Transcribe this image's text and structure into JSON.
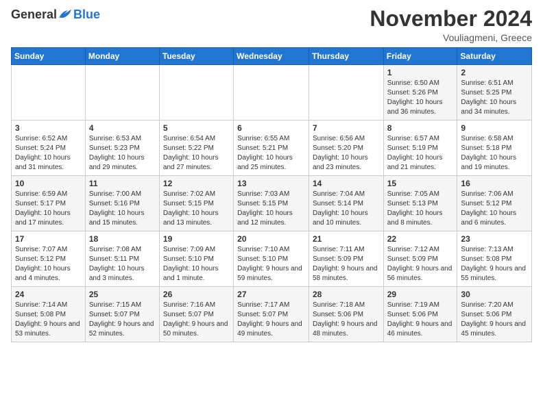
{
  "header": {
    "logo_general": "General",
    "logo_blue": "Blue",
    "month_title": "November 2024",
    "location": "Vouliagmeni, Greece"
  },
  "calendar": {
    "days_of_week": [
      "Sunday",
      "Monday",
      "Tuesday",
      "Wednesday",
      "Thursday",
      "Friday",
      "Saturday"
    ],
    "weeks": [
      [
        {
          "day": "",
          "info": ""
        },
        {
          "day": "",
          "info": ""
        },
        {
          "day": "",
          "info": ""
        },
        {
          "day": "",
          "info": ""
        },
        {
          "day": "",
          "info": ""
        },
        {
          "day": "1",
          "info": "Sunrise: 6:50 AM\nSunset: 5:26 PM\nDaylight: 10 hours and 36 minutes."
        },
        {
          "day": "2",
          "info": "Sunrise: 6:51 AM\nSunset: 5:25 PM\nDaylight: 10 hours and 34 minutes."
        }
      ],
      [
        {
          "day": "3",
          "info": "Sunrise: 6:52 AM\nSunset: 5:24 PM\nDaylight: 10 hours and 31 minutes."
        },
        {
          "day": "4",
          "info": "Sunrise: 6:53 AM\nSunset: 5:23 PM\nDaylight: 10 hours and 29 minutes."
        },
        {
          "day": "5",
          "info": "Sunrise: 6:54 AM\nSunset: 5:22 PM\nDaylight: 10 hours and 27 minutes."
        },
        {
          "day": "6",
          "info": "Sunrise: 6:55 AM\nSunset: 5:21 PM\nDaylight: 10 hours and 25 minutes."
        },
        {
          "day": "7",
          "info": "Sunrise: 6:56 AM\nSunset: 5:20 PM\nDaylight: 10 hours and 23 minutes."
        },
        {
          "day": "8",
          "info": "Sunrise: 6:57 AM\nSunset: 5:19 PM\nDaylight: 10 hours and 21 minutes."
        },
        {
          "day": "9",
          "info": "Sunrise: 6:58 AM\nSunset: 5:18 PM\nDaylight: 10 hours and 19 minutes."
        }
      ],
      [
        {
          "day": "10",
          "info": "Sunrise: 6:59 AM\nSunset: 5:17 PM\nDaylight: 10 hours and 17 minutes."
        },
        {
          "day": "11",
          "info": "Sunrise: 7:00 AM\nSunset: 5:16 PM\nDaylight: 10 hours and 15 minutes."
        },
        {
          "day": "12",
          "info": "Sunrise: 7:02 AM\nSunset: 5:15 PM\nDaylight: 10 hours and 13 minutes."
        },
        {
          "day": "13",
          "info": "Sunrise: 7:03 AM\nSunset: 5:15 PM\nDaylight: 10 hours and 12 minutes."
        },
        {
          "day": "14",
          "info": "Sunrise: 7:04 AM\nSunset: 5:14 PM\nDaylight: 10 hours and 10 minutes."
        },
        {
          "day": "15",
          "info": "Sunrise: 7:05 AM\nSunset: 5:13 PM\nDaylight: 10 hours and 8 minutes."
        },
        {
          "day": "16",
          "info": "Sunrise: 7:06 AM\nSunset: 5:12 PM\nDaylight: 10 hours and 6 minutes."
        }
      ],
      [
        {
          "day": "17",
          "info": "Sunrise: 7:07 AM\nSunset: 5:12 PM\nDaylight: 10 hours and 4 minutes."
        },
        {
          "day": "18",
          "info": "Sunrise: 7:08 AM\nSunset: 5:11 PM\nDaylight: 10 hours and 3 minutes."
        },
        {
          "day": "19",
          "info": "Sunrise: 7:09 AM\nSunset: 5:10 PM\nDaylight: 10 hours and 1 minute."
        },
        {
          "day": "20",
          "info": "Sunrise: 7:10 AM\nSunset: 5:10 PM\nDaylight: 9 hours and 59 minutes."
        },
        {
          "day": "21",
          "info": "Sunrise: 7:11 AM\nSunset: 5:09 PM\nDaylight: 9 hours and 58 minutes."
        },
        {
          "day": "22",
          "info": "Sunrise: 7:12 AM\nSunset: 5:09 PM\nDaylight: 9 hours and 56 minutes."
        },
        {
          "day": "23",
          "info": "Sunrise: 7:13 AM\nSunset: 5:08 PM\nDaylight: 9 hours and 55 minutes."
        }
      ],
      [
        {
          "day": "24",
          "info": "Sunrise: 7:14 AM\nSunset: 5:08 PM\nDaylight: 9 hours and 53 minutes."
        },
        {
          "day": "25",
          "info": "Sunrise: 7:15 AM\nSunset: 5:07 PM\nDaylight: 9 hours and 52 minutes."
        },
        {
          "day": "26",
          "info": "Sunrise: 7:16 AM\nSunset: 5:07 PM\nDaylight: 9 hours and 50 minutes."
        },
        {
          "day": "27",
          "info": "Sunrise: 7:17 AM\nSunset: 5:07 PM\nDaylight: 9 hours and 49 minutes."
        },
        {
          "day": "28",
          "info": "Sunrise: 7:18 AM\nSunset: 5:06 PM\nDaylight: 9 hours and 48 minutes."
        },
        {
          "day": "29",
          "info": "Sunrise: 7:19 AM\nSunset: 5:06 PM\nDaylight: 9 hours and 46 minutes."
        },
        {
          "day": "30",
          "info": "Sunrise: 7:20 AM\nSunset: 5:06 PM\nDaylight: 9 hours and 45 minutes."
        }
      ]
    ]
  }
}
